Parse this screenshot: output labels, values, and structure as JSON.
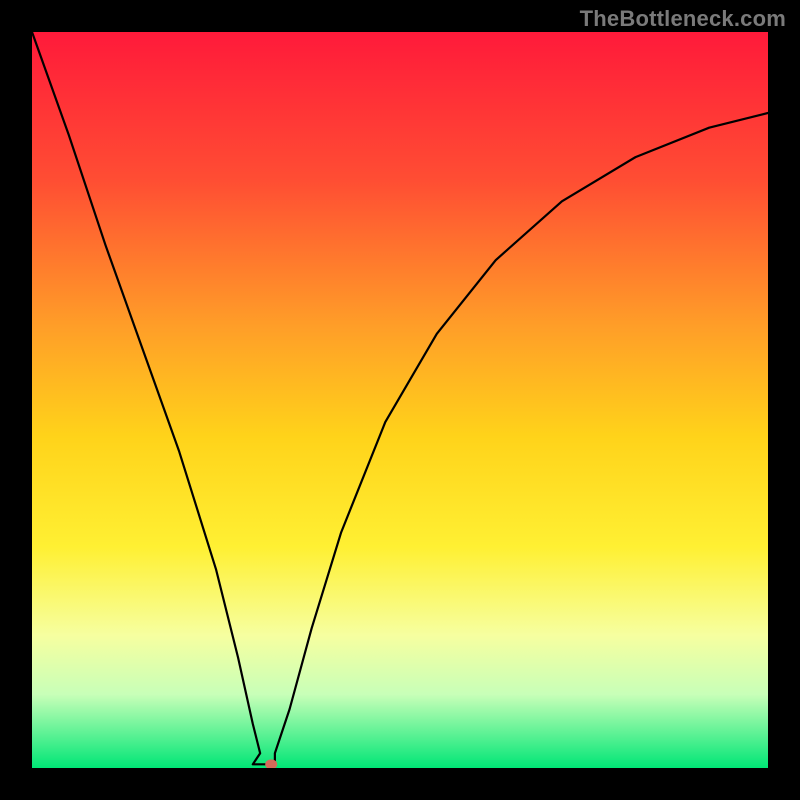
{
  "watermark": "TheBottleneck.com",
  "chart_data": {
    "type": "line",
    "title": "",
    "xlabel": "",
    "ylabel": "",
    "xlim": [
      0,
      100
    ],
    "ylim": [
      0,
      100
    ],
    "grid": false,
    "legend": false,
    "background_gradient": {
      "stops": [
        {
          "offset": 0.0,
          "color": "#ff1a3a"
        },
        {
          "offset": 0.2,
          "color": "#ff4d33"
        },
        {
          "offset": 0.4,
          "color": "#ff9e28"
        },
        {
          "offset": 0.55,
          "color": "#ffd31a"
        },
        {
          "offset": 0.7,
          "color": "#fff033"
        },
        {
          "offset": 0.82,
          "color": "#f6ffa0"
        },
        {
          "offset": 0.9,
          "color": "#c8ffb8"
        },
        {
          "offset": 1.0,
          "color": "#00e676"
        }
      ]
    },
    "curve": {
      "x": [
        0,
        5,
        10,
        15,
        20,
        25,
        28,
        30,
        31,
        32,
        33,
        35,
        38,
        42,
        48,
        55,
        63,
        72,
        82,
        92,
        100
      ],
      "y": [
        100,
        86,
        71,
        57,
        43,
        27,
        15,
        6,
        2,
        0.5,
        2,
        8,
        19,
        32,
        47,
        59,
        69,
        77,
        83,
        87,
        89
      ]
    },
    "vertex_flat": {
      "x_start": 30,
      "x_end": 33,
      "y": 0.5
    },
    "marker": {
      "x": 32.5,
      "y": 0.5,
      "color": "#d46a5a",
      "rx": 6,
      "ry": 5
    }
  }
}
